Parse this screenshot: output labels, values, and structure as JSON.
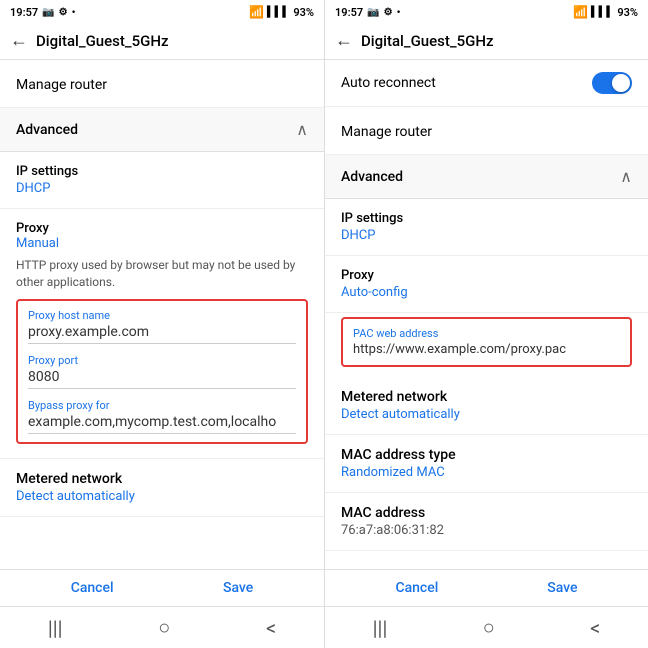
{
  "panel1": {
    "status": {
      "time": "19:57",
      "battery": "93%"
    },
    "toolbar": {
      "back_icon": "←",
      "title": "Digital_Guest_5GHz"
    },
    "manage_router": "Manage router",
    "advanced": {
      "label": "Advanced",
      "chevron": "∧"
    },
    "ip_settings": {
      "label": "IP settings",
      "value": "DHCP"
    },
    "proxy": {
      "label": "Proxy",
      "value": "Manual",
      "description": "HTTP proxy used by browser but may not be used by other applications."
    },
    "proxy_fields": {
      "host": {
        "label": "Proxy host name",
        "value": "proxy.example.com"
      },
      "port": {
        "label": "Proxy port",
        "value": "8080"
      },
      "bypass": {
        "label": "Bypass proxy for",
        "value": "example.com,mycomp.test.com,localho"
      }
    },
    "metered_network": {
      "label": "Metered network",
      "value": "Detect automatically"
    },
    "buttons": {
      "cancel": "Cancel",
      "save": "Save"
    },
    "nav": {
      "menu": "|||",
      "home": "○",
      "back": "<"
    }
  },
  "panel2": {
    "status": {
      "time": "19:57",
      "battery": "93%"
    },
    "toolbar": {
      "back_icon": "←",
      "title": "Digital_Guest_5GHz"
    },
    "auto_reconnect": {
      "label": "Auto reconnect"
    },
    "manage_router": "Manage router",
    "advanced": {
      "label": "Advanced",
      "chevron": "∧"
    },
    "ip_settings": {
      "label": "IP settings",
      "value": "DHCP"
    },
    "proxy": {
      "label": "Proxy",
      "value": "Auto-config"
    },
    "pac_address": {
      "label": "PAC web address",
      "value": "https://www.example.com/proxy.pac"
    },
    "metered_network": {
      "label": "Metered network",
      "value": "Detect automatically"
    },
    "mac_address_type": {
      "label": "MAC address type",
      "value": "Randomized MAC"
    },
    "mac_address": {
      "label": "MAC address",
      "value": "76:a7:a8:06:31:82"
    },
    "buttons": {
      "cancel": "Cancel",
      "save": "Save"
    },
    "nav": {
      "menu": "|||",
      "home": "○",
      "back": "<"
    }
  }
}
